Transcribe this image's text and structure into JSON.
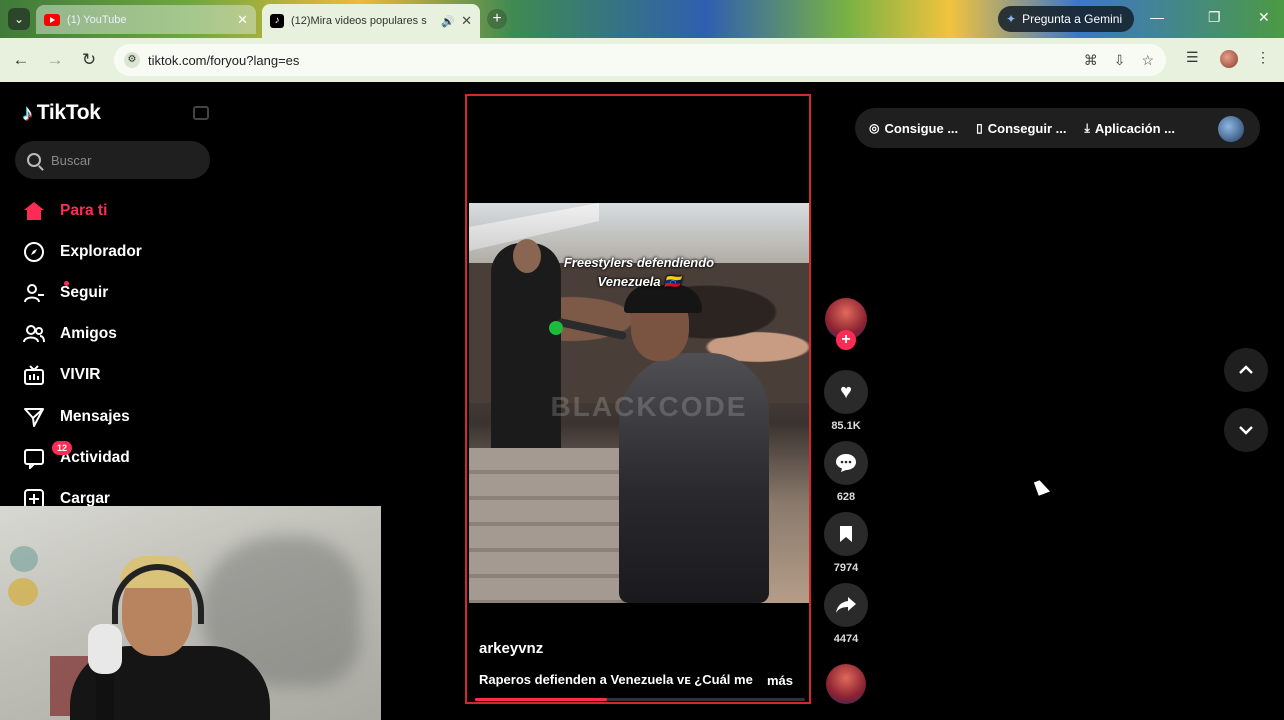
{
  "browser": {
    "tabs": [
      {
        "title": "(1) YouTube",
        "active": false
      },
      {
        "title": "(12)Mira videos populares s",
        "active": true
      }
    ],
    "new_tab": "+",
    "gemini_label": "Pregunta a Gemini",
    "url": "tiktok.com/foryou?lang=es"
  },
  "tiktok": {
    "logo_text": "TikTok",
    "search_placeholder": "Buscar",
    "nav": [
      {
        "label": "Para ti",
        "icon": "home-icon",
        "active": true
      },
      {
        "label": "Explorador",
        "icon": "compass-icon"
      },
      {
        "label": "Seguir",
        "icon": "follow-icon"
      },
      {
        "label": "Amigos",
        "icon": "friends-icon"
      },
      {
        "label": "VIVIR",
        "icon": "live-icon"
      },
      {
        "label": "Mensajes",
        "icon": "messages-icon"
      },
      {
        "label": "Actividad",
        "icon": "activity-icon",
        "badge": "12"
      },
      {
        "label": "Cargar",
        "icon": "upload-icon"
      }
    ],
    "video": {
      "caption_line1": "Freestylers defendiendo",
      "caption_line2": "Venezuela 🇻🇪",
      "watermark": "BLACKCODE",
      "author": "arkeyvnz",
      "description": "Raperos defienden a Venezuela ᴠᴇ ¿Cuál me",
      "more": "más",
      "progress": 0.4
    },
    "actions": {
      "likes": "85.1K",
      "comments": "628",
      "saves": "7974",
      "shares": "4474"
    },
    "promo": {
      "item1": "Consigue ...",
      "item2": "Conseguir ...",
      "item3": "Aplicación ..."
    }
  },
  "colors": {
    "accent": "#fe2c55",
    "chrome_bar": "#e8f1dd"
  }
}
